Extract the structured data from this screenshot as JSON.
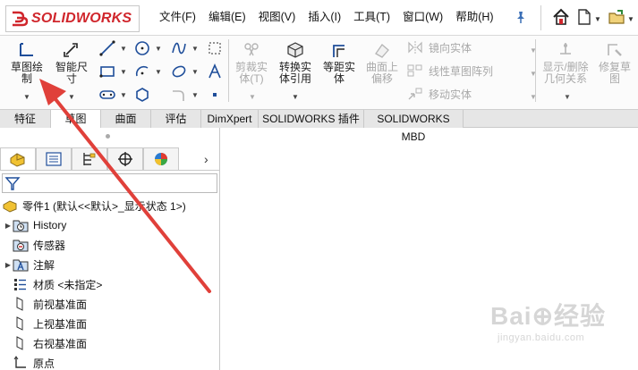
{
  "app": {
    "brand_prefix": "3S",
    "brand_name": "SOLIDWORKS"
  },
  "menubar": {
    "items": [
      "文件(F)",
      "编辑(E)",
      "视图(V)",
      "插入(I)",
      "工具(T)",
      "窗口(W)",
      "帮助(H)"
    ]
  },
  "ribbon": {
    "sketch": {
      "line1": "草图绘",
      "line2": "制"
    },
    "smart_dim": {
      "line1": "智能尺",
      "line2": "寸"
    },
    "trim": {
      "line1": "剪裁实",
      "line2": "体(T)"
    },
    "convert": {
      "line1": "转换实",
      "line2": "体引用"
    },
    "offset": {
      "line1": "等距实",
      "line2": "体"
    },
    "surface_offset": {
      "line1": "曲面上",
      "line2": "偏移"
    },
    "mirror": "镜向实体",
    "linear_pattern": "线性草图阵列",
    "move": "移动实体",
    "display_delete": {
      "line1": "显示/删除",
      "line2": "几何关系"
    },
    "repair": {
      "line1": "修复草",
      "line2": "图"
    }
  },
  "tabs": [
    {
      "label": "特征",
      "active": false
    },
    {
      "label": "草图",
      "active": true
    },
    {
      "label": "曲面",
      "active": false
    },
    {
      "label": "评估",
      "active": false
    },
    {
      "label": "DimXpert",
      "active": false
    },
    {
      "label": "SOLIDWORKS 插件",
      "active": false
    },
    {
      "label": "SOLIDWORKS MBD",
      "active": false
    }
  ],
  "tree": {
    "root": "零件1  (默认<<默认>_显示状态 1>)",
    "items": [
      {
        "label": "History",
        "expandable": true
      },
      {
        "label": "传感器",
        "expandable": false
      },
      {
        "label": "注解",
        "expandable": true
      },
      {
        "label": "材质 <未指定>",
        "expandable": false
      },
      {
        "label": "前视基准面",
        "expandable": false
      },
      {
        "label": "上视基准面",
        "expandable": false
      },
      {
        "label": "右视基准面",
        "expandable": false
      },
      {
        "label": "原点",
        "expandable": false
      }
    ]
  },
  "watermark": {
    "main": "Bai⊕经验",
    "sub": "jingyan.baidu.com"
  },
  "colors": {
    "accent_red": "#d0262c",
    "arrow_red": "#e0403a",
    "top_strip": "#4b88a8",
    "tab_bg": "#e6e6e6"
  }
}
